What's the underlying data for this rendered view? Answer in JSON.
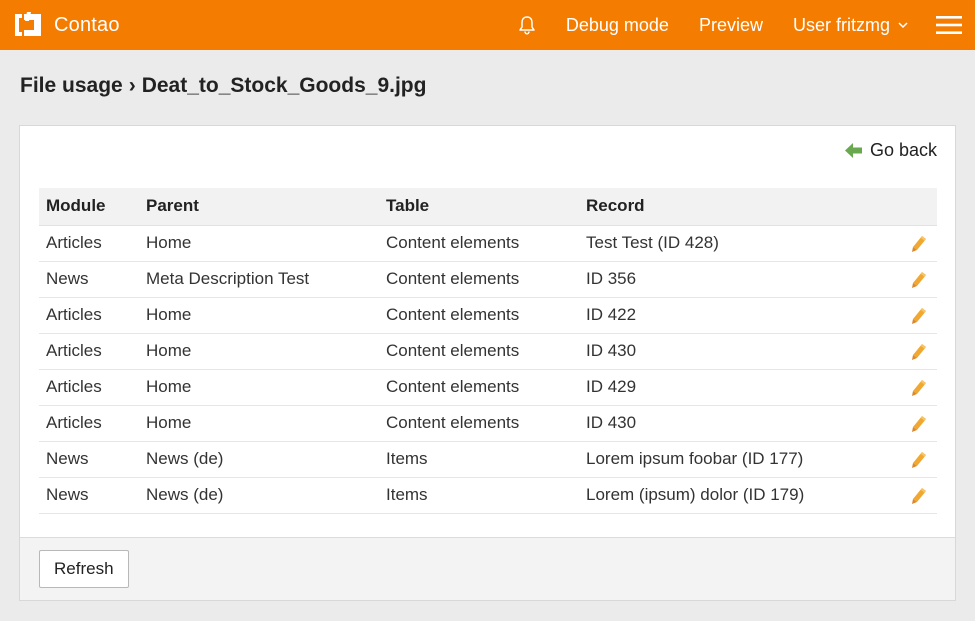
{
  "header": {
    "brand": "Contao",
    "bell_icon": "bell-icon",
    "debug_mode": "Debug mode",
    "preview": "Preview",
    "user_menu": "User fritzmg",
    "menu_icon": "hamburger-menu-icon",
    "accent_color": "#f47c00"
  },
  "title": {
    "main": "File usage",
    "separator": "›",
    "file": "Deat_to_Stock_Goods_9.jpg"
  },
  "panel": {
    "go_back": "Go back",
    "go_back_icon": "arrow-left-icon"
  },
  "table": {
    "headers": [
      "Module",
      "Parent",
      "Table",
      "Record"
    ],
    "rows": [
      {
        "module": "Articles",
        "parent": "Home",
        "table": "Content elements",
        "record": "Test Test (ID 428)"
      },
      {
        "module": "News",
        "parent": "Meta Description Test",
        "table": "Content elements",
        "record": "ID 356"
      },
      {
        "module": "Articles",
        "parent": "Home",
        "table": "Content elements",
        "record": "ID 422"
      },
      {
        "module": "Articles",
        "parent": "Home",
        "table": "Content elements",
        "record": "ID 430"
      },
      {
        "module": "Articles",
        "parent": "Home",
        "table": "Content elements",
        "record": "ID 429"
      },
      {
        "module": "Articles",
        "parent": "Home",
        "table": "Content elements",
        "record": "ID 430"
      },
      {
        "module": "News",
        "parent": "News (de)",
        "table": "Items",
        "record": "Lorem ipsum foobar (ID 177)"
      },
      {
        "module": "News",
        "parent": "News (de)",
        "table": "Items",
        "record": "Lorem (ipsum) dolor (ID 179)"
      }
    ],
    "edit_icon": "pencil-icon"
  },
  "footer": {
    "refresh": "Refresh"
  }
}
